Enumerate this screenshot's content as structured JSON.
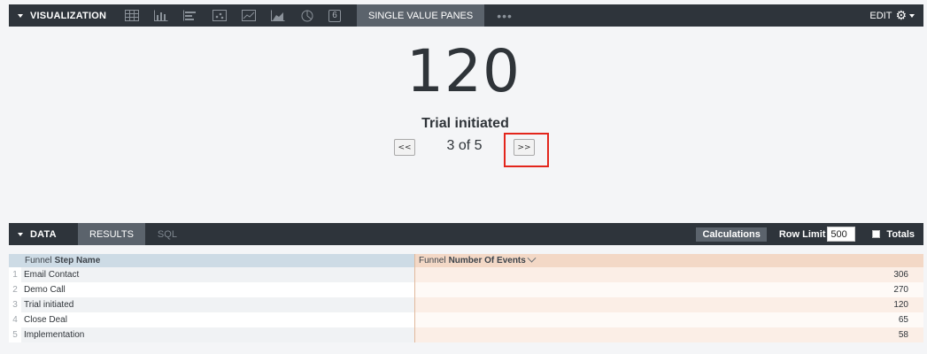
{
  "visualization": {
    "section_label": "VISUALIZATION",
    "icons": [
      "table-icon",
      "column-chart-icon",
      "bar-chart-icon",
      "scatter-icon",
      "line-chart-icon",
      "area-chart-icon",
      "pie-chart-icon",
      "single-value-icon"
    ],
    "single_value_icon_text": "6",
    "active_tab": "SINGLE VALUE PANES",
    "more_label": "•••",
    "edit_label": "EDIT",
    "gear_glyph": "⚙"
  },
  "single_value": {
    "value": "120",
    "label": "Trial initiated",
    "prev_label": "<<",
    "next_label": ">>",
    "pager_text": "3 of 5"
  },
  "data_panel": {
    "section_label": "DATA",
    "tabs": [
      "RESULTS",
      "SQL"
    ],
    "calculations_label": "Calculations",
    "row_limit_label": "Row Limit",
    "row_limit_value": "500",
    "totals_label": "Totals"
  },
  "table": {
    "columns": [
      {
        "prefix": "Funnel",
        "name": "Step Name"
      },
      {
        "prefix": "Funnel",
        "name": "Number Of Events"
      }
    ],
    "rows": [
      {
        "index": "1",
        "step": "Email Contact",
        "events": "306"
      },
      {
        "index": "2",
        "step": "Demo Call",
        "events": "270"
      },
      {
        "index": "3",
        "step": "Trial initiated",
        "events": "120"
      },
      {
        "index": "4",
        "step": "Close Deal",
        "events": "65"
      },
      {
        "index": "5",
        "step": "Implementation",
        "events": "58"
      }
    ]
  },
  "colors": {
    "bar_bg": "#2e343b",
    "active_tab_bg": "#5b636c",
    "dimension_header": "#cddbe5",
    "measure_header": "#f3d8c6",
    "highlight_border": "#e3261c"
  }
}
